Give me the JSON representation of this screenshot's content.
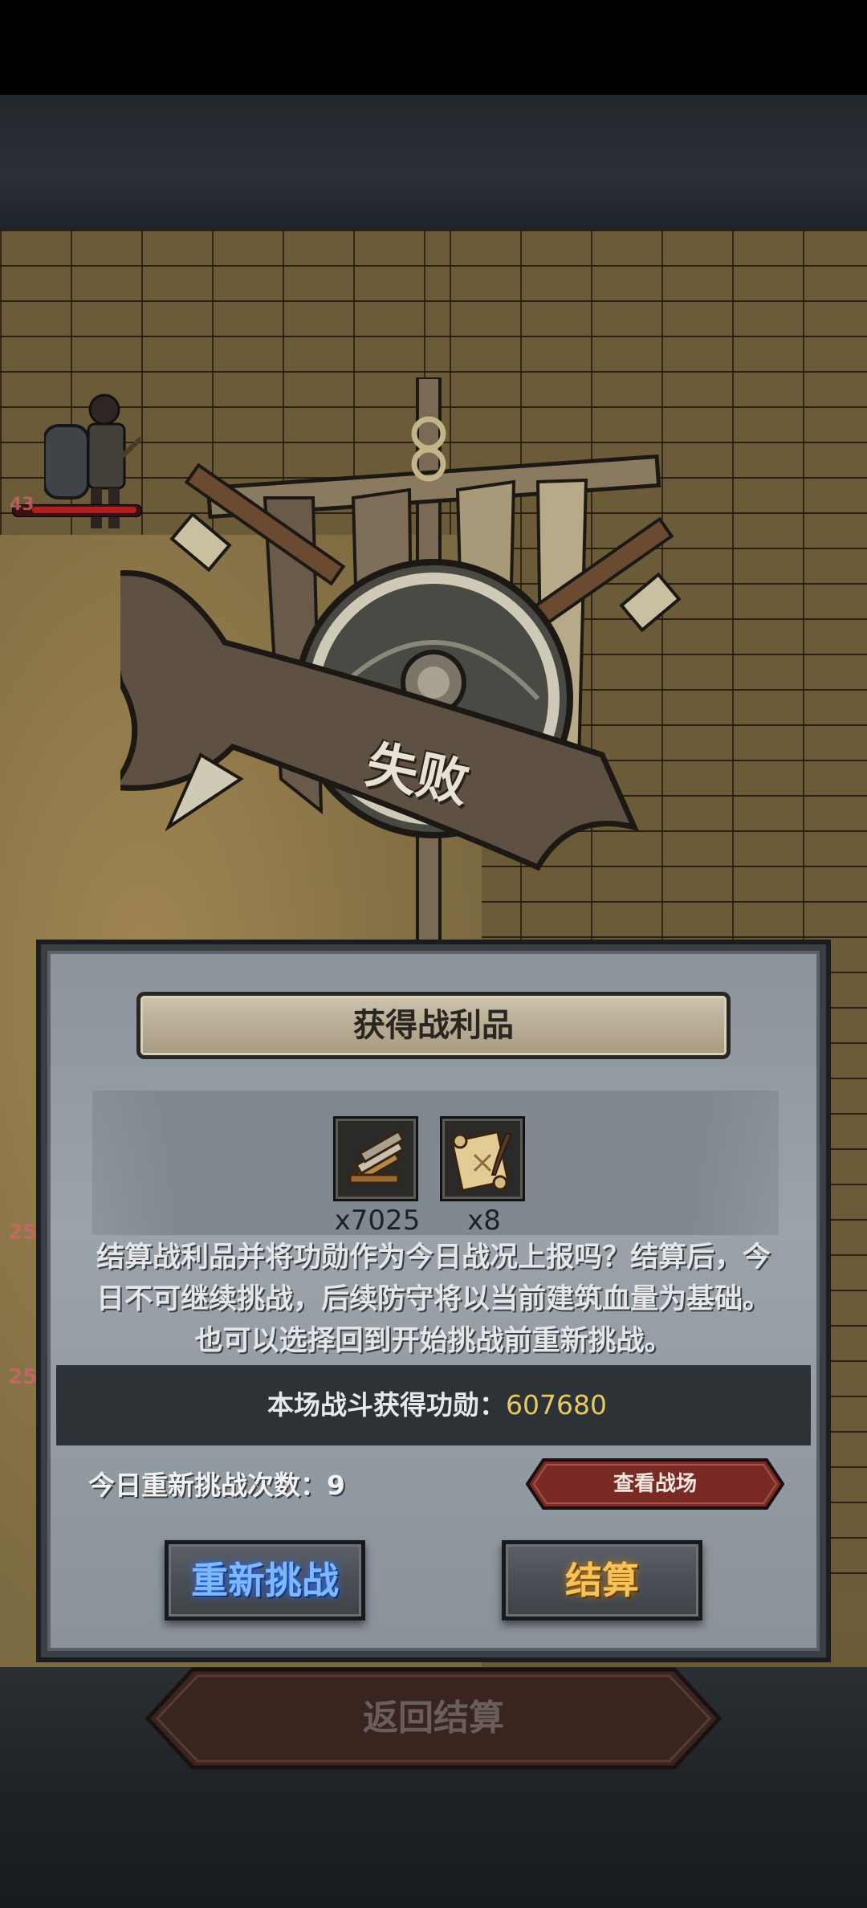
{
  "result": {
    "title": "失败"
  },
  "loot_panel": {
    "title": "获得战利品",
    "items": [
      {
        "icon": "planks-icon",
        "count": "x7025"
      },
      {
        "icon": "scroll-quill-icon",
        "count": "x8"
      }
    ],
    "description": "结算战利品并将功勋作为今日战况上报吗？结算后，今日不可继续挑战，后续防守将以当前建筑血量为基础。也可以选择回到开始挑战前重新挑战。",
    "merit_label": "本场战斗获得功勋：",
    "merit_value": "607680",
    "retry_count_label": "今日重新挑战次数：",
    "retry_count_value": "9",
    "view_battle_label": "查看战场",
    "retry_button_label": "重新挑战",
    "settle_button_label": "结算"
  },
  "return_button_label": "返回结算",
  "scene": {
    "enemy_level": "43",
    "side_numbers": [
      "25",
      "25"
    ]
  },
  "colors": {
    "merit_value": "#e8c860",
    "retry_button_text": "#7eb8ff",
    "settle_button_text": "#f6c25a",
    "view_battle_button": "#7a2a24"
  }
}
